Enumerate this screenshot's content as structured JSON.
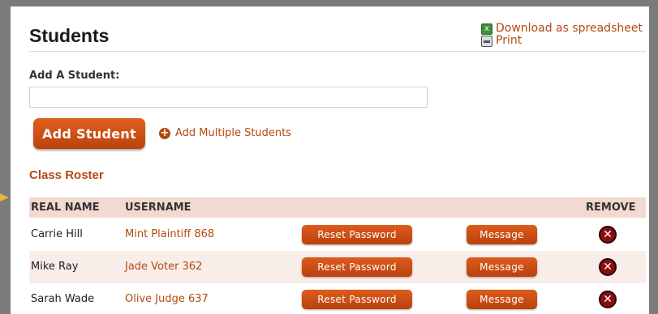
{
  "page": {
    "title": "Students"
  },
  "header_links": {
    "download": "Download as spreadsheet",
    "print": "Print"
  },
  "add_form": {
    "label": "Add A Student:",
    "input_value": "",
    "button": "Add Student",
    "multi_link": "Add Multiple Students"
  },
  "roster": {
    "title": "Class Roster",
    "columns": {
      "real_name": "REAL NAME",
      "username": "USERNAME",
      "remove": "REMOVE"
    },
    "reset_label": "Reset Password",
    "message_label": "Message",
    "rows": [
      {
        "name": "Carrie Hill",
        "username": "Mint Plaintiff 868"
      },
      {
        "name": "Mike Ray",
        "username": "Jade Voter 362"
      },
      {
        "name": "Sarah Wade",
        "username": "Olive Judge 637"
      }
    ]
  },
  "colors": {
    "accent": "#b34a12",
    "button": "#cd4f14",
    "header_bg": "#f2d9d1",
    "remove": "#8b0d0d"
  },
  "icons": {
    "spreadsheet": "spreadsheet-icon",
    "print": "printer-icon",
    "add": "plus-circle-icon",
    "remove": "remove-x-icon"
  }
}
